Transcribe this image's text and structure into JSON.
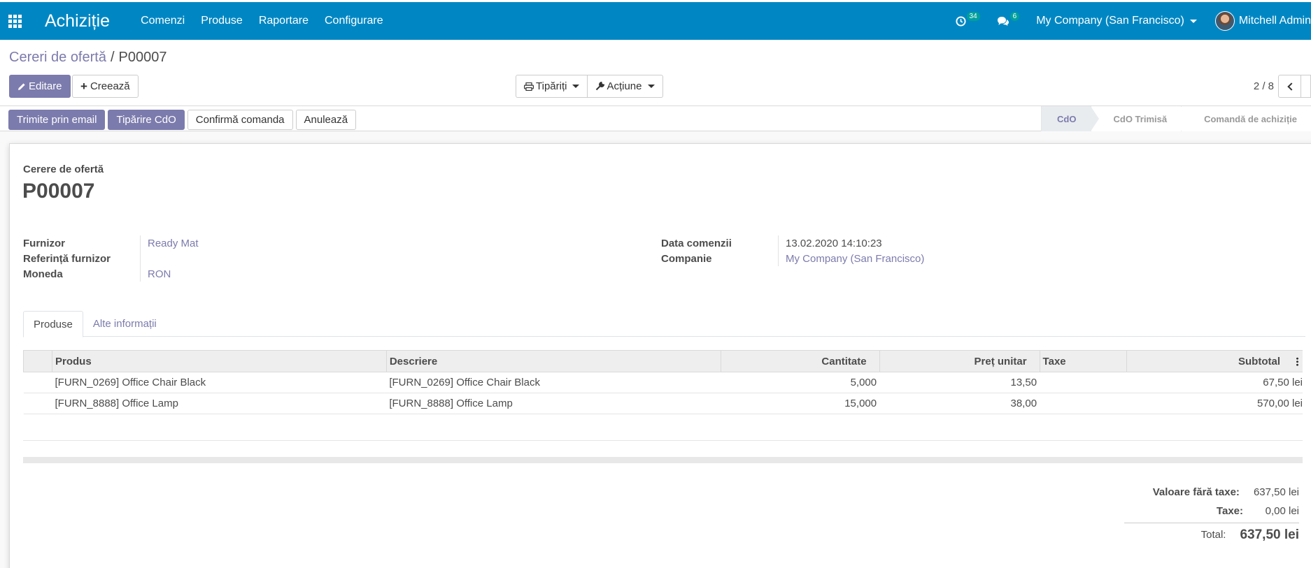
{
  "navbar": {
    "app_name": "Achiziție",
    "menu": [
      "Comenzi",
      "Produse",
      "Raportare",
      "Configurare"
    ],
    "activity_count": "34",
    "messages_count": "6",
    "company": "My Company (San Francisco)",
    "user": "Mitchell Admin"
  },
  "breadcrumb": {
    "parent": "Cereri de ofertă",
    "current": "P00007"
  },
  "toolbar": {
    "edit_label": "Editare",
    "create_label": "Creează",
    "print_label": "Tipăriți",
    "action_label": "Acțiune",
    "pager_value": "2 / 8"
  },
  "status_buttons": {
    "send_email": "Trimite prin email",
    "print_rfq": "Tipărire CdO",
    "confirm_order": "Confirmă comanda",
    "cancel": "Anulează"
  },
  "stages": [
    "CdO",
    "CdO Trimisă",
    "Comandă de achiziție"
  ],
  "form": {
    "doc_label": "Cerere de ofertă",
    "doc_title": "P00007",
    "left_fields": [
      {
        "label": "Furnizor",
        "value": "Ready Mat"
      },
      {
        "label": "Referință furnizor",
        "value": ""
      },
      {
        "label": "Moneda",
        "value": "RON"
      }
    ],
    "right_fields": [
      {
        "label": "Data comenzii",
        "value": "13.02.2020 14:10:23"
      },
      {
        "label": "Companie",
        "value": "My Company (San Francisco)"
      }
    ],
    "tabs": [
      "Produse",
      "Alte informații"
    ]
  },
  "lines": {
    "headers": {
      "product": "Produs",
      "description": "Descriere",
      "quantity": "Cantitate",
      "unit_price": "Preț unitar",
      "taxes": "Taxe",
      "subtotal": "Subtotal"
    },
    "rows": [
      {
        "product": "[FURN_0269] Office Chair Black",
        "description": "[FURN_0269] Office Chair Black",
        "quantity": "5,000",
        "unit_price": "13,50",
        "taxes": "",
        "subtotal": "67,50 lei"
      },
      {
        "product": "[FURN_8888] Office Lamp",
        "description": "[FURN_8888] Office Lamp",
        "quantity": "15,000",
        "unit_price": "38,00",
        "taxes": "",
        "subtotal": "570,00 lei"
      }
    ]
  },
  "totals": {
    "untaxed_label": "Valoare fără taxe:",
    "untaxed_value": "637,50 lei",
    "taxes_label": "Taxe:",
    "taxes_value": "0,00 lei",
    "total_label": "Total:",
    "total_value": "637,50 lei"
  },
  "colors": {
    "navbar": "#0087c3",
    "primary": "#7c7bad"
  }
}
